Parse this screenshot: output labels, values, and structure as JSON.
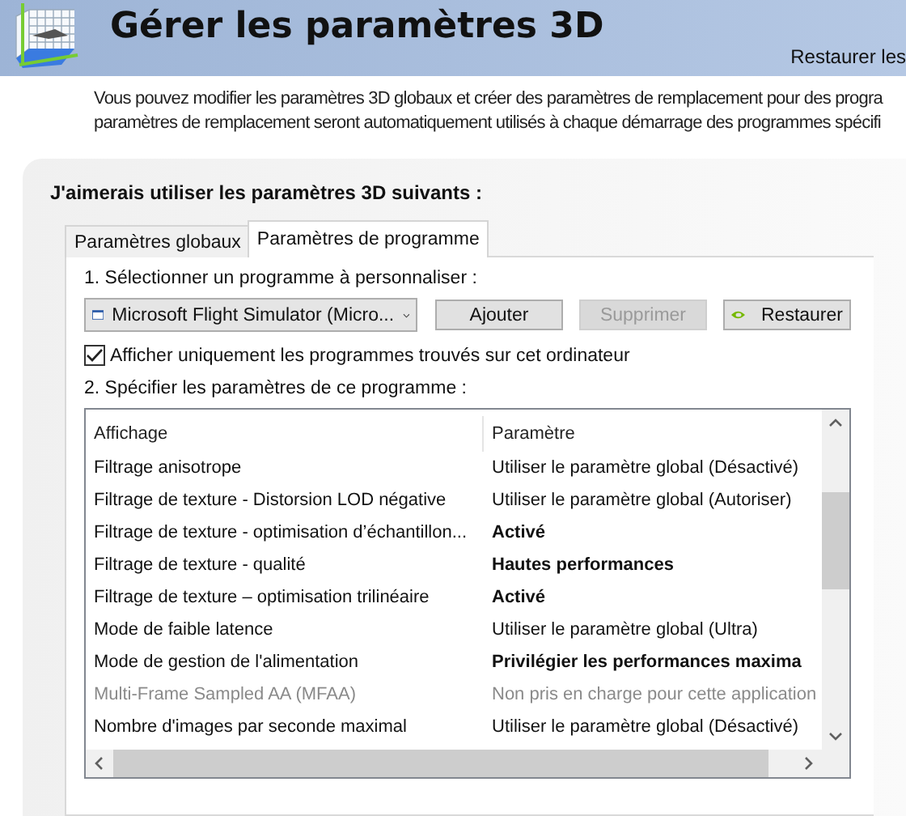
{
  "header": {
    "title": "Gérer les paramètres 3D",
    "restore_link": "Restaurer les"
  },
  "description": [
    "Vous pouvez modifier les paramètres 3D globaux et créer des paramètres de remplacement pour des progra",
    "paramètres de remplacement seront automatiquement utilisés à chaque démarrage des programmes spécifi"
  ],
  "panel": {
    "heading": "J'aimerais utiliser les paramètres 3D suivants :",
    "tabs": [
      {
        "label": "Paramètres globaux",
        "selected": false
      },
      {
        "label": "Paramètres de programme",
        "selected": true
      }
    ],
    "step1": "1. Sélectionner un programme à personnaliser :",
    "program": {
      "value": "Microsoft Flight Simulator (Micro..."
    },
    "buttons": [
      {
        "label": "Ajouter",
        "disabled": false,
        "kind": "plain"
      },
      {
        "label": "Supprimer",
        "disabled": true,
        "kind": "plain"
      },
      {
        "label": "Restaurer",
        "disabled": false,
        "kind": "logo"
      }
    ],
    "filter": {
      "label": "Afficher uniquement les programmes trouvés sur cet ordinateur",
      "checked": true
    },
    "step2": "2. Spécifier les paramètres de ce programme :",
    "table": {
      "columns": [
        "Affichage",
        "Paramètre"
      ],
      "rows": [
        {
          "feature": "Filtrage anisotrope",
          "setting": "Utiliser le paramètre global (Désactivé)",
          "overridden": false,
          "disabled": false
        },
        {
          "feature": "Filtrage de texture - Distorsion LOD négative",
          "setting": "Utiliser le paramètre global (Autoriser)",
          "overridden": false,
          "disabled": false
        },
        {
          "feature": "Filtrage de texture - optimisation d’échantillon...",
          "setting": "Activé",
          "overridden": true,
          "disabled": false
        },
        {
          "feature": "Filtrage de texture - qualité",
          "setting": "Hautes performances",
          "overridden": true,
          "disabled": false
        },
        {
          "feature": "Filtrage de texture – optimisation trilinéaire",
          "setting": "Activé",
          "overridden": true,
          "disabled": false
        },
        {
          "feature": "Mode de faible latence",
          "setting": "Utiliser le paramètre global (Ultra)",
          "overridden": false,
          "disabled": false
        },
        {
          "feature": "Mode de gestion de l'alimentation",
          "setting": "Privilégier les performances maxima",
          "overridden": true,
          "disabled": false
        },
        {
          "feature": "Multi-Frame Sampled AA (MFAA)",
          "setting": "Non pris en charge pour cette application",
          "overridden": false,
          "disabled": true
        },
        {
          "feature": "Nombre d'images par seconde maximal",
          "setting": "Utiliser le paramètre global (Désactivé)",
          "overridden": false,
          "disabled": false
        }
      ]
    }
  }
}
